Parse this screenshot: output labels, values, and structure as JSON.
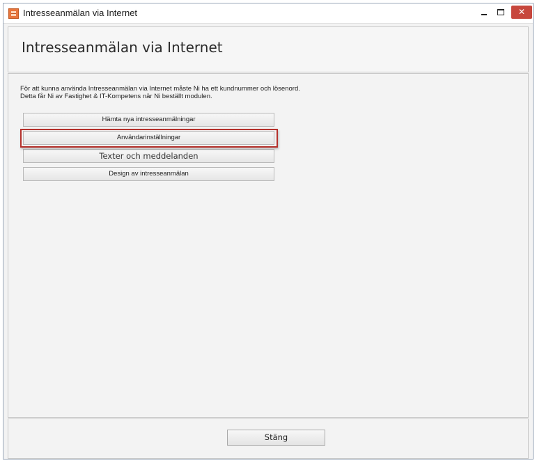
{
  "window": {
    "title": "Intresseanmälan via Internet",
    "controls": {
      "minimize": "minimize-icon",
      "maximize": "maximize-icon",
      "close": "close-icon",
      "close_color": "#c7473d"
    }
  },
  "header": {
    "title": "Intresseanmälan via Internet"
  },
  "content": {
    "info_line1": "För att kunna använda Intresseanmälan via Internet måste Ni ha ett kundnummer och lösenord.",
    "info_line2": "Detta får Ni av Fastighet & IT-Kompetens när Ni beställt modulen.",
    "buttons": [
      {
        "label": "Hämta nya intresseanmälningar"
      },
      {
        "label": "Användarinställningar",
        "highlighted": true
      },
      {
        "label": "Texter och meddelanden"
      },
      {
        "label": "Design av intresseanmälan"
      }
    ],
    "highlight_color": "#b5312c"
  },
  "footer": {
    "close_label": "Stäng"
  }
}
